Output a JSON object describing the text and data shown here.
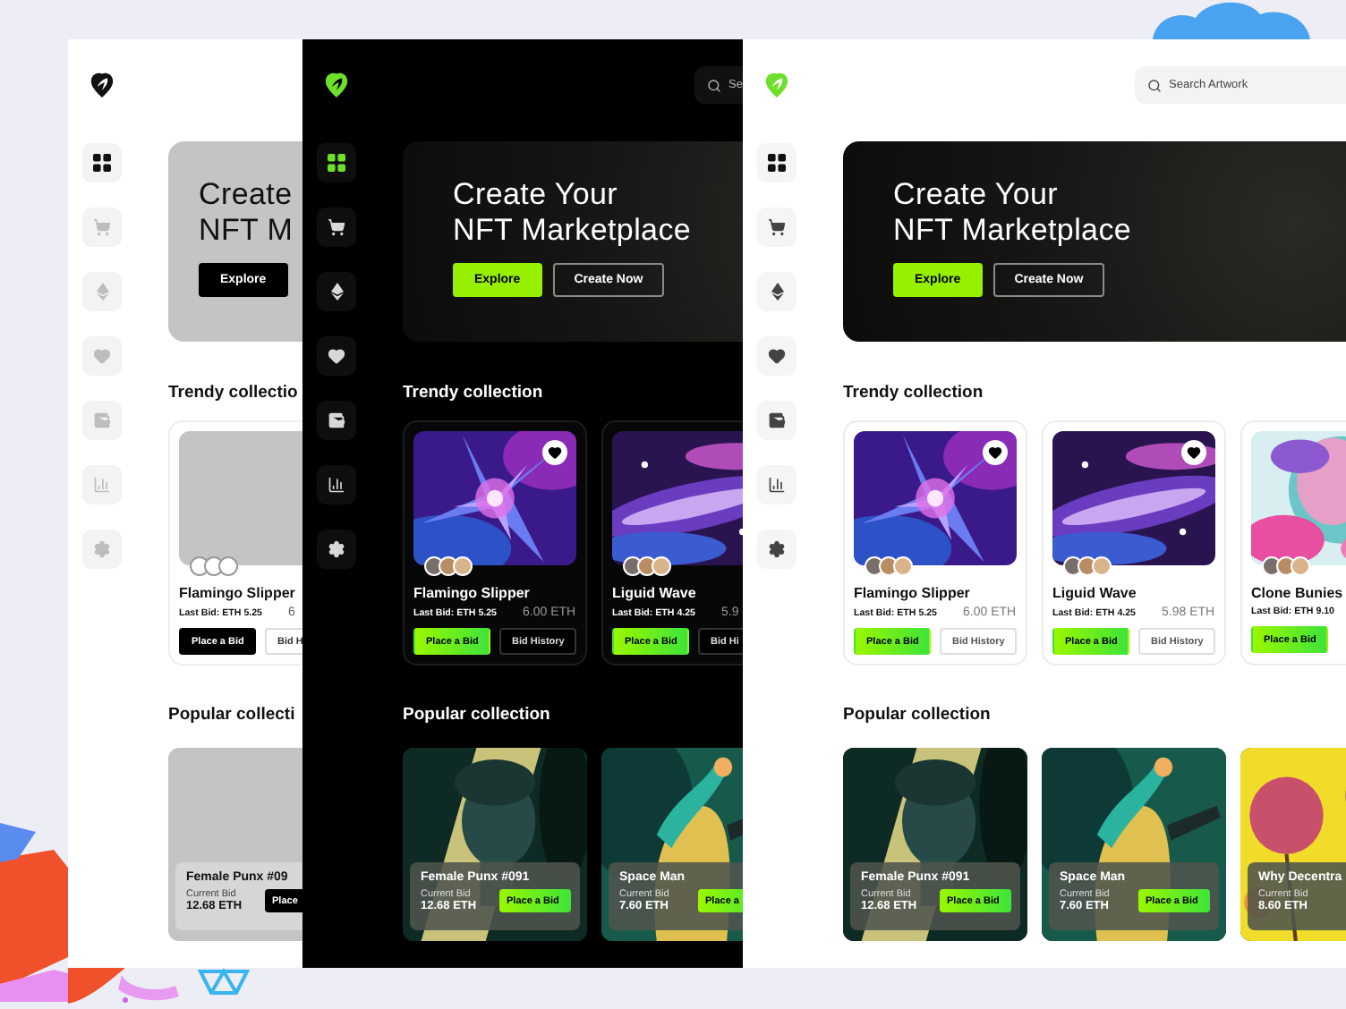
{
  "panels": [
    {
      "nav": [
        {
          "selected": true
        },
        {
          "selected": false
        },
        {
          "selected": false
        },
        {
          "selected": false
        },
        {
          "selected": false
        },
        {
          "selected": false
        },
        {
          "selected": false
        }
      ],
      "hero": {
        "title": [
          "Create",
          "NFT M"
        ],
        "buttons": [
          {
            "label": "Explore",
            "kind": "primary"
          }
        ]
      },
      "trendy": {
        "heading": "Trendy collectio",
        "cards": [
          {
            "title": "Flamingo Slipper",
            "last_bid": "Last Bid: ETH 5.25",
            "price": "6",
            "buttons": [
              "Place a Bid",
              "Bid H"
            ]
          }
        ]
      },
      "popular": {
        "heading": "Popular collecti",
        "cards": [
          {
            "title": "Female Punx #09",
            "bid_label": "Current Bid",
            "bid": "12.68 ETH",
            "button": "Place"
          }
        ]
      }
    },
    {
      "search": {
        "placeholder": "Se"
      },
      "nav": [
        {
          "selected": true
        },
        {
          "selected": false
        },
        {
          "selected": false
        },
        {
          "selected": false
        },
        {
          "selected": false
        },
        {
          "selected": false
        },
        {
          "selected": false
        }
      ],
      "hero": {
        "title": [
          "Create Your",
          "NFT Marketplace"
        ],
        "buttons": [
          {
            "label": "Explore",
            "kind": "primary"
          },
          {
            "label": "Create Now",
            "kind": "outline"
          }
        ]
      },
      "trendy": {
        "heading": "Trendy collection",
        "cards": [
          {
            "title": "Flamingo Slipper",
            "last_bid": "Last Bid: ETH 5.25",
            "price": "6.00 ETH",
            "buttons": [
              "Place a Bid",
              "Bid History"
            ]
          },
          {
            "title": "Liguid Wave",
            "last_bid": "Last Bid: ETH 4.25",
            "price": "5.9",
            "buttons": [
              "Place a Bid",
              "Bid Hi"
            ]
          }
        ]
      },
      "popular": {
        "heading": "Popular collection",
        "cards": [
          {
            "title": "Female Punx #091",
            "bid_label": "Current Bid",
            "bid": "12.68 ETH",
            "button": "Place a Bid"
          },
          {
            "title": "Space Man",
            "bid_label": "Current Bid",
            "bid": "7.60 ETH",
            "button": "Place a"
          }
        ]
      }
    },
    {
      "search": {
        "placeholder": "Search Artwork"
      },
      "nav": [
        {
          "selected": true
        },
        {
          "selected": false
        },
        {
          "selected": false
        },
        {
          "selected": false
        },
        {
          "selected": false
        },
        {
          "selected": false
        },
        {
          "selected": false
        }
      ],
      "hero": {
        "title": [
          "Create Your",
          "NFT Marketplace"
        ],
        "buttons": [
          {
            "label": "Explore",
            "kind": "primary"
          },
          {
            "label": "Create Now",
            "kind": "outline"
          }
        ]
      },
      "trendy": {
        "heading": "Trendy collection",
        "cards": [
          {
            "title": "Flamingo Slipper",
            "last_bid": "Last Bid: ETH 5.25",
            "price": "6.00 ETH",
            "buttons": [
              "Place a Bid",
              "Bid History"
            ]
          },
          {
            "title": "Liguid Wave",
            "last_bid": "Last Bid: ETH 4.25",
            "price": "5.98 ETH",
            "buttons": [
              "Place a Bid",
              "Bid History"
            ]
          },
          {
            "title": "Clone Bunies",
            "last_bid": "Last Bid: ETH 9.10",
            "buttons": [
              "Place a Bid"
            ]
          }
        ]
      },
      "popular": {
        "heading": "Popular collection",
        "cards": [
          {
            "title": "Female Punx #091",
            "bid_label": "Current Bid",
            "bid": "12.68 ETH",
            "button": "Place a Bid"
          },
          {
            "title": "Space Man",
            "bid_label": "Current Bid",
            "bid": "7.60 ETH",
            "button": "Place a Bid"
          },
          {
            "title": "Why Decentra",
            "bid_label": "Current Bid",
            "bid": "8.60 ETH"
          }
        ]
      }
    }
  ]
}
